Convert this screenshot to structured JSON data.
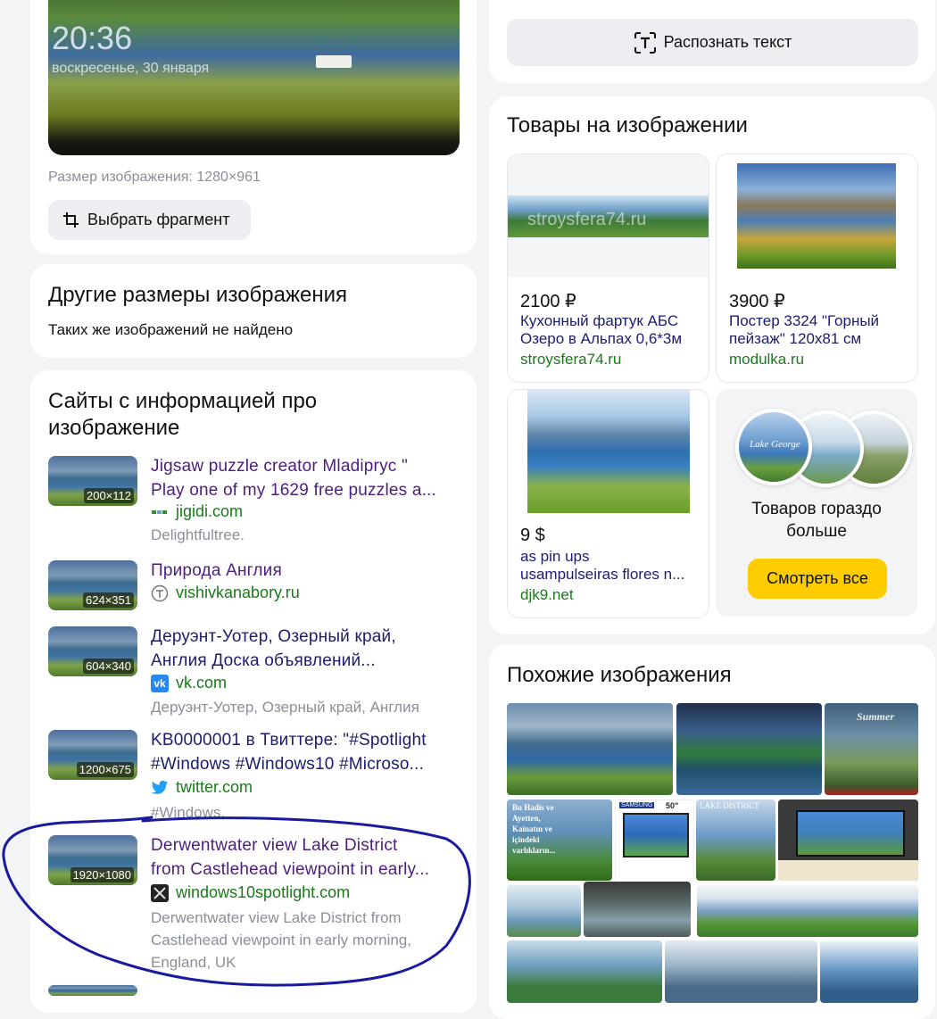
{
  "hero": {
    "clock": "20:36",
    "date": "воскресенье, 30 января",
    "size_text": "Размер изображения: 1280×961",
    "fragment_button": "Выбрать фрагмент"
  },
  "recognize": {
    "button": "Распознать текст"
  },
  "other_sizes": {
    "title": "Другие размеры изображения",
    "text": "Таких же изображений не найдено"
  },
  "sites": {
    "title_line1": "Сайты с информацией про",
    "title_line2": "изображение",
    "items": [
      {
        "size": "200×112",
        "title1": "Jigsaw puzzle creator Mladipryc \"",
        "title2": "Play one of my 1629 free puzzles a...",
        "domain": "jigidi.com",
        "desc": "Delightfultree."
      },
      {
        "size": "624×351",
        "title1": "Природа Англия",
        "title2": "",
        "domain": "vishivkanabory.ru",
        "desc": ""
      },
      {
        "size": "604×340",
        "title1": "Деруэнт-Уотер, Озерный край,",
        "title2": "Англия Доска объявлений...",
        "domain": "vk.com",
        "desc": "Деруэнт-Уотер, Озерный край, Англия"
      },
      {
        "size": "1200×675",
        "title1": "KB0000001 в Твиттере: \"#Spotlight",
        "title2": "#Windows #Windows10 #Microso...",
        "domain": "twitter.com",
        "desc": "#Windows."
      },
      {
        "size": "1920×1080",
        "title1": "Derwentwater view Lake District",
        "title2": "from Castlehead viewpoint in early...",
        "domain": "windows10spotlight.com",
        "desc1": "Derwentwater view Lake District from",
        "desc2": "Castlehead viewpoint in early morning,",
        "desc3": "England, UK"
      }
    ]
  },
  "goods": {
    "title": "Товары на изображении",
    "items": [
      {
        "price": "2100 ₽",
        "name1": "Кухонный фартук АБС",
        "name2": "Озеро в Альпах 0,6*3м",
        "shop": "stroysfera74.ru",
        "watermark": "stroysfera74.ru"
      },
      {
        "price": "3900 ₽",
        "name1": "Постер 3324 \"Горный",
        "name2": "пейзаж\" 120x81 см",
        "shop": "modulka.ru"
      },
      {
        "price": "9 $",
        "name1": "as pin ups",
        "name2": "usampulseiras flores n...",
        "shop": "djk9.net"
      }
    ],
    "more_text1": "Товаров гораздо",
    "more_text2": "больше",
    "more_button": "Смотреть все",
    "circle_label": "Lake George"
  },
  "similar": {
    "title": "Похожие изображения",
    "overlay_summer": "Summer",
    "overlay_bu": "Bu Hadis ve Ayetten, Kainatın ve içindeki varlıkların...",
    "overlay_samsung": "SAMSUNG",
    "overlay_50": "50\"",
    "overlay_lake": "LAKE DISTRICT"
  },
  "colors": {
    "link_visited": "#4b1e7d",
    "link": "#1b1c6e",
    "domain": "#1a7a1a",
    "accent_button": "#ffcc00",
    "annotation": "#1a1a9e"
  }
}
